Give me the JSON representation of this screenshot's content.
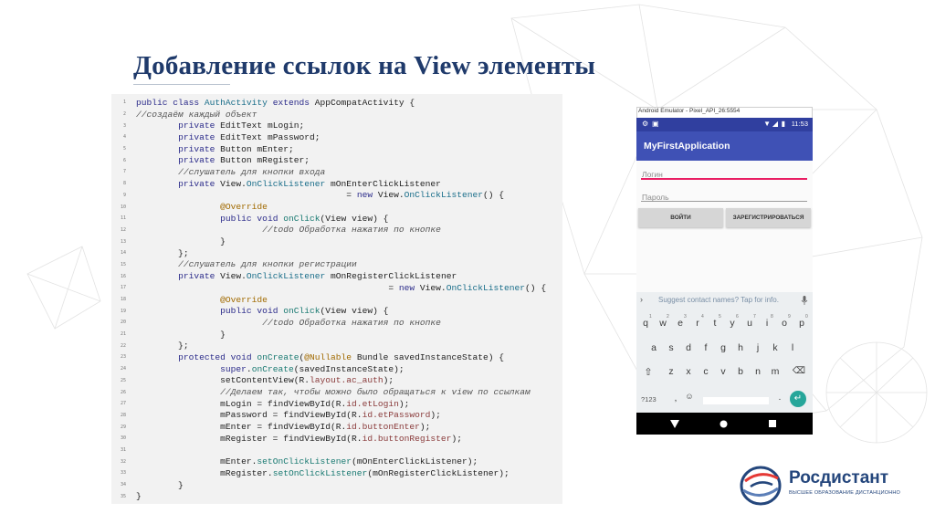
{
  "slide": {
    "title": "Добавление ссылок на View элементы"
  },
  "code": {
    "lines": [
      {
        "n": "1",
        "t": [
          [
            "kw",
            "public class "
          ],
          [
            "cls",
            "AuthActivity"
          ],
          [
            "kw",
            " extends "
          ],
          [
            "pl",
            "AppCompatActivity {"
          ]
        ]
      },
      {
        "n": "2",
        "t": [
          [
            "cm",
            "//создаём каждый объект"
          ]
        ]
      },
      {
        "n": "3",
        "t": [
          [
            "pl",
            "        "
          ],
          [
            "kw",
            "private "
          ],
          [
            "pl",
            "EditText mLogin;"
          ]
        ]
      },
      {
        "n": "4",
        "t": [
          [
            "pl",
            "        "
          ],
          [
            "kw",
            "private "
          ],
          [
            "pl",
            "EditText mPassword;"
          ]
        ]
      },
      {
        "n": "5",
        "t": [
          [
            "pl",
            "        "
          ],
          [
            "kw",
            "private "
          ],
          [
            "pl",
            "Button mEnter;"
          ]
        ]
      },
      {
        "n": "6",
        "t": [
          [
            "pl",
            "        "
          ],
          [
            "kw",
            "private "
          ],
          [
            "pl",
            "Button mRegister;"
          ]
        ]
      },
      {
        "n": "7",
        "t": [
          [
            "pl",
            "        "
          ],
          [
            "cm",
            "//слушатель для кнопки входа"
          ]
        ]
      },
      {
        "n": "8",
        "t": [
          [
            "pl",
            "        "
          ],
          [
            "kw",
            "private "
          ],
          [
            "pl",
            "View."
          ],
          [
            "cls",
            "OnClickListener"
          ],
          [
            "pl",
            " mOnEnterClickListener"
          ]
        ]
      },
      {
        "n": "9",
        "t": [
          [
            "pl",
            "                                        = "
          ],
          [
            "kw",
            "new "
          ],
          [
            "pl",
            "View."
          ],
          [
            "cls",
            "OnClickListener"
          ],
          [
            "pl",
            "() {"
          ]
        ]
      },
      {
        "n": "10",
        "t": [
          [
            "pl",
            "                "
          ],
          [
            "an",
            "@Override"
          ]
        ]
      },
      {
        "n": "11",
        "t": [
          [
            "pl",
            "                "
          ],
          [
            "kw",
            "public void "
          ],
          [
            "mt",
            "onClick"
          ],
          [
            "pl",
            "(View view) {"
          ]
        ]
      },
      {
        "n": "12",
        "t": [
          [
            "pl",
            "                        "
          ],
          [
            "cm",
            "//todo Обработка нажатия по кнопке"
          ]
        ]
      },
      {
        "n": "13",
        "t": [
          [
            "pl",
            "                }"
          ]
        ]
      },
      {
        "n": "14",
        "t": [
          [
            "pl",
            "        };"
          ]
        ]
      },
      {
        "n": "15",
        "t": [
          [
            "pl",
            "        "
          ],
          [
            "cm",
            "//слушатель для кнопки регистрации"
          ]
        ]
      },
      {
        "n": "16",
        "t": [
          [
            "pl",
            "        "
          ],
          [
            "kw",
            "private "
          ],
          [
            "pl",
            "View."
          ],
          [
            "cls",
            "OnClickListener"
          ],
          [
            "pl",
            " mOnRegisterClickListener"
          ]
        ]
      },
      {
        "n": "17",
        "t": [
          [
            "pl",
            "                                                = "
          ],
          [
            "kw",
            "new "
          ],
          [
            "pl",
            "View."
          ],
          [
            "cls",
            "OnClickListener"
          ],
          [
            "pl",
            "() {"
          ]
        ]
      },
      {
        "n": "18",
        "t": [
          [
            "pl",
            "                "
          ],
          [
            "an",
            "@Override"
          ]
        ]
      },
      {
        "n": "19",
        "t": [
          [
            "pl",
            "                "
          ],
          [
            "kw",
            "public void "
          ],
          [
            "mt",
            "onClick"
          ],
          [
            "pl",
            "(View view) {"
          ]
        ]
      },
      {
        "n": "20",
        "t": [
          [
            "pl",
            "                        "
          ],
          [
            "cm",
            "//todo Обработка нажатия по кнопке"
          ]
        ]
      },
      {
        "n": "21",
        "t": [
          [
            "pl",
            "                }"
          ]
        ]
      },
      {
        "n": "22",
        "t": [
          [
            "pl",
            "        };"
          ]
        ]
      },
      {
        "n": "23",
        "t": [
          [
            "pl",
            "        "
          ],
          [
            "kw",
            "protected void "
          ],
          [
            "mt",
            "onCreate"
          ],
          [
            "pl",
            "("
          ],
          [
            "an",
            "@Nullable"
          ],
          [
            "pl",
            " Bundle savedInstanceState) {"
          ]
        ]
      },
      {
        "n": "24",
        "t": [
          [
            "pl",
            "                "
          ],
          [
            "kw",
            "super"
          ],
          [
            "pl",
            "."
          ],
          [
            "mt",
            "onCreate"
          ],
          [
            "pl",
            "(savedInstanceState);"
          ]
        ]
      },
      {
        "n": "25",
        "t": [
          [
            "pl",
            "                setContentView(R."
          ],
          [
            "str",
            "layout.ac_auth"
          ],
          [
            "pl",
            ");"
          ]
        ]
      },
      {
        "n": "26",
        "t": [
          [
            "pl",
            "                "
          ],
          [
            "cm",
            "//Делаем так, чтобы можно было обращаться к view по ссылкам"
          ]
        ]
      },
      {
        "n": "27",
        "t": [
          [
            "pl",
            "                mLogin = findViewById(R."
          ],
          [
            "str",
            "id.etLogin"
          ],
          [
            "pl",
            ");"
          ]
        ]
      },
      {
        "n": "28",
        "t": [
          [
            "pl",
            "                mPassword = findViewById(R."
          ],
          [
            "str",
            "id.etPassword"
          ],
          [
            "pl",
            ");"
          ]
        ]
      },
      {
        "n": "29",
        "t": [
          [
            "pl",
            "                mEnter = findViewById(R."
          ],
          [
            "str",
            "id.buttonEnter"
          ],
          [
            "pl",
            ");"
          ]
        ]
      },
      {
        "n": "30",
        "t": [
          [
            "pl",
            "                mRegister = findViewById(R."
          ],
          [
            "str",
            "id.buttonRegister"
          ],
          [
            "pl",
            ");"
          ]
        ]
      },
      {
        "n": "31",
        "t": [
          [
            "pl",
            ""
          ]
        ]
      },
      {
        "n": "32",
        "t": [
          [
            "pl",
            "                mEnter."
          ],
          [
            "mt",
            "setOnClickListener"
          ],
          [
            "pl",
            "(mOnEnterClickListener);"
          ]
        ]
      },
      {
        "n": "33",
        "t": [
          [
            "pl",
            "                mRegister."
          ],
          [
            "mt",
            "setOnClickListener"
          ],
          [
            "pl",
            "(mOnRegisterClickListener);"
          ]
        ]
      },
      {
        "n": "34",
        "t": [
          [
            "pl",
            "        }"
          ]
        ]
      },
      {
        "n": "35",
        "t": [
          [
            "pl",
            "}"
          ]
        ]
      }
    ]
  },
  "emulator": {
    "window_title": "Android Emulator - Pixel_API_26:5554",
    "status_time": "11:53",
    "app_title": "MyFirstApplication",
    "login_placeholder": "Логин",
    "password_placeholder": "Пароль",
    "enter_button": "ВОЙТИ",
    "register_button": "ЗАРЕГИСТРИРОВАТЬСЯ",
    "suggestion": "Suggest contact names? Tap for info.",
    "keyboard_row1": [
      "q",
      "w",
      "e",
      "r",
      "t",
      "y",
      "u",
      "i",
      "o",
      "p"
    ],
    "keyboard_row1_digits": [
      "1",
      "2",
      "3",
      "4",
      "5",
      "6",
      "7",
      "8",
      "9",
      "0"
    ],
    "keyboard_row2": [
      "a",
      "s",
      "d",
      "f",
      "g",
      "h",
      "j",
      "k",
      "l"
    ],
    "keyboard_row3": [
      "z",
      "x",
      "c",
      "v",
      "b",
      "n",
      "m"
    ],
    "symbols_key": "?123",
    "comma_key": ",",
    "period_key": "."
  },
  "logo": {
    "name": "Росдистант",
    "tagline": "ВЫСШЕЕ ОБРАЗОВАНИЕ ДИСТАНЦИОННО"
  },
  "colors": {
    "title": "#1f3a6b",
    "status_bar": "#303f9f",
    "app_bar": "#3f51b5",
    "accent": "#e91e63",
    "enter_key": "#26a69a",
    "logo": "#24467c"
  },
  "icons": [
    "search-icon",
    "wifi-icon",
    "signal-icon",
    "battery-icon",
    "chevron-right-icon",
    "mic-icon",
    "shift-icon",
    "backspace-icon",
    "emoji-icon",
    "enter-icon",
    "back-nav-icon",
    "home-nav-icon",
    "recents-nav-icon"
  ]
}
